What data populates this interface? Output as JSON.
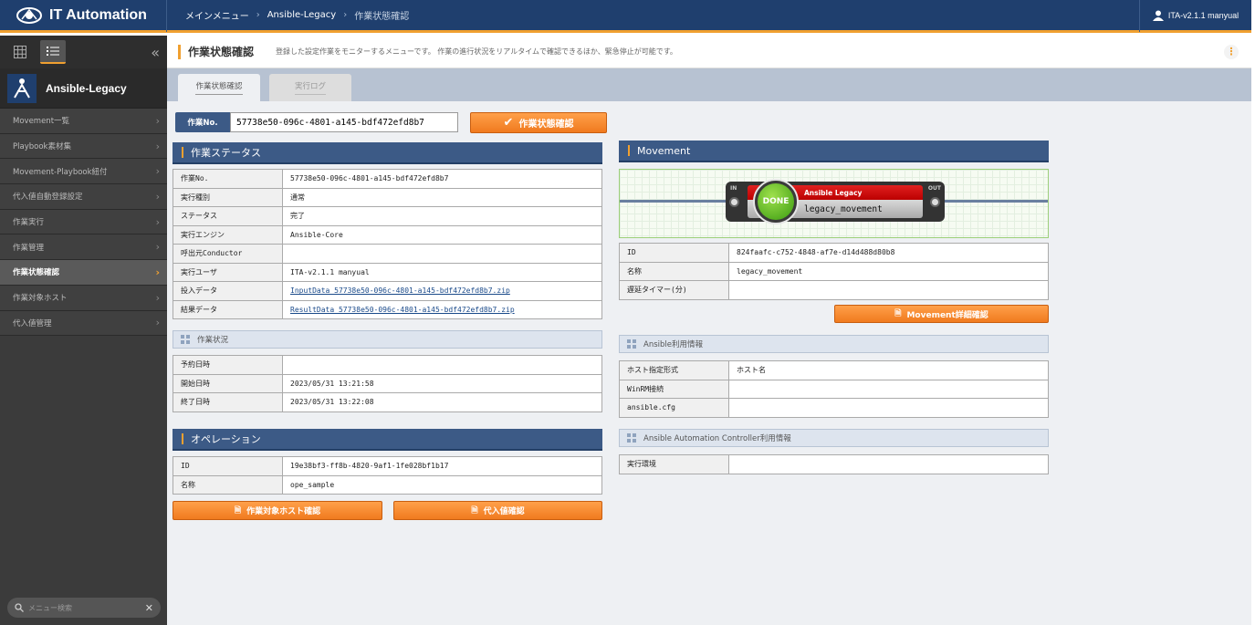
{
  "header": {
    "app_title": "IT Automation",
    "breadcrumb": [
      "メインメニュー",
      "Ansible-Legacy",
      "作業状態確認"
    ],
    "user": "ITA-v2.1.1 manyual"
  },
  "sidebar": {
    "app_name": "Ansible-Legacy",
    "items": [
      {
        "label": "Movement一覧"
      },
      {
        "label": "Playbook素材集"
      },
      {
        "label": "Movement-Playbook紐付"
      },
      {
        "label": "代入値自動登録設定"
      },
      {
        "label": "作業実行"
      },
      {
        "label": "作業管理"
      },
      {
        "label": "作業状態確認"
      },
      {
        "label": "作業対象ホスト"
      },
      {
        "label": "代入値管理"
      }
    ],
    "search_placeholder": "メニュー検索"
  },
  "page": {
    "title": "作業状態確認",
    "description": "登録した設定作業をモニターするメニューです。 作業の進行状況をリアルタイムで確認できるほか、緊急停止が可能です。",
    "tabs": [
      {
        "label": "作業状態確認"
      },
      {
        "label": "実行ログ"
      }
    ]
  },
  "opno": {
    "label": "作業No.",
    "value": "57738e50-096c-4801-a145-bdf472efd8b7",
    "button": "作業状態確認"
  },
  "work_status": {
    "title": "作業ステータス",
    "rows": [
      {
        "k": "作業No.",
        "v": "57738e50-096c-4801-a145-bdf472efd8b7"
      },
      {
        "k": "実行種別",
        "v": "通常"
      },
      {
        "k": "ステータス",
        "v": "完了"
      },
      {
        "k": "実行エンジン",
        "v": "Ansible-Core"
      },
      {
        "k": "呼出元Conductor",
        "v": ""
      },
      {
        "k": "実行ユーザ",
        "v": "ITA-v2.1.1 manyual"
      },
      {
        "k": "投入データ",
        "v": "InputData_57738e50-096c-4801-a145-bdf472efd8b7.zip"
      },
      {
        "k": "結果データ",
        "v": "ResultData_57738e50-096c-4801-a145-bdf472efd8b7.zip"
      }
    ]
  },
  "work_state": {
    "title": "作業状況",
    "rows": [
      {
        "k": "予約日時",
        "v": ""
      },
      {
        "k": "開始日時",
        "v": "2023/05/31 13:21:58"
      },
      {
        "k": "終了日時",
        "v": "2023/05/31 13:22:08"
      }
    ]
  },
  "operation": {
    "title": "オペレーション",
    "rows": [
      {
        "k": "ID",
        "v": "19e38bf3-ff8b-4820-9af1-1fe028bf1b17"
      },
      {
        "k": "名称",
        "v": "ope_sample"
      }
    ],
    "btn_hosts": "作業対象ホスト確認",
    "btn_values": "代入値確認"
  },
  "movement": {
    "title": "Movement",
    "node": {
      "in": "IN",
      "out": "OUT",
      "status": "DONE",
      "type": "Ansible Legacy",
      "name": "legacy_movement"
    },
    "rows": [
      {
        "k": "ID",
        "v": "824faafc-c752-4848-af7e-d14d488d80b8"
      },
      {
        "k": "名称",
        "v": "legacy_movement"
      },
      {
        "k": "遅延タイマー(分)",
        "v": ""
      }
    ],
    "btn_detail": "Movement詳細確認"
  },
  "ansible_info": {
    "title": "Ansible利用情報",
    "rows": [
      {
        "k": "ホスト指定形式",
        "v": "ホスト名"
      },
      {
        "k": "WinRM接続",
        "v": ""
      },
      {
        "k": "ansible.cfg",
        "v": ""
      }
    ]
  },
  "aac_info": {
    "title": "Ansible Automation Controller利用情報",
    "rows": [
      {
        "k": "実行環境",
        "v": ""
      }
    ]
  }
}
